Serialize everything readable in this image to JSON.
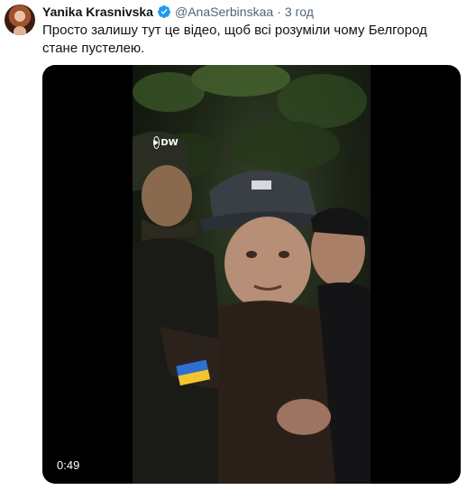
{
  "tweet": {
    "author_name": "Yanika Krasnivska",
    "handle": "@AnaSerbinskaa",
    "separator": "·",
    "time": "3 год",
    "text": "Просто залишу тут це відео, щоб всі розуміли чому Белгород стане пустелею."
  },
  "media": {
    "duration": "0:49",
    "watermark": "DW"
  },
  "icons": {
    "verified": "verified-badge-icon",
    "patch": "ukraine-flag-patch",
    "watermark": "dw-logo-icon"
  },
  "colors": {
    "verified": "#1d9bf0",
    "text": "#0f1419",
    "secondary": "#536471",
    "media_bg": "#000000"
  }
}
